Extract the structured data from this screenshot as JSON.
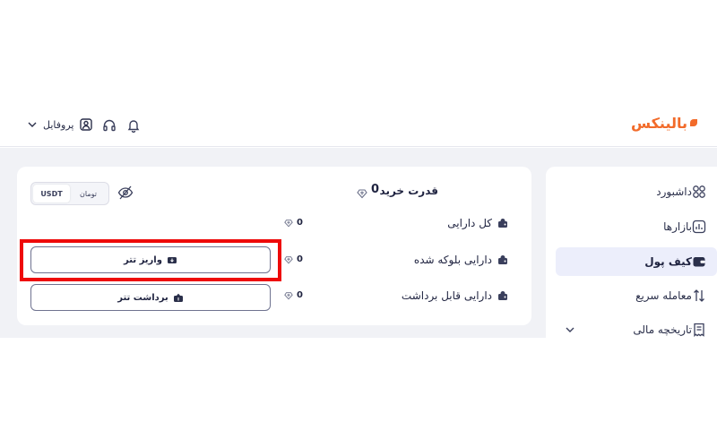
{
  "header": {
    "logo_text": "بالینکس",
    "profile_label": "پروفایل",
    "icons": [
      "bell-icon",
      "headset-icon",
      "user-icon",
      "chevron-down-icon"
    ]
  },
  "sidebar": {
    "items": [
      {
        "label": "داشبورد",
        "icon": "grid-icon",
        "active": false
      },
      {
        "label": "بازارها",
        "icon": "chart-icon",
        "active": false
      },
      {
        "label": "کیف پول",
        "icon": "wallet-icon",
        "active": true
      },
      {
        "label": "معامله سریع",
        "icon": "swap-icon",
        "active": false
      },
      {
        "label": "تاریخچه مالی",
        "icon": "receipt-icon",
        "active": false
      }
    ]
  },
  "wallet": {
    "buying_power_label": "قدرت خرید",
    "buying_power_value": "0",
    "currency_toggle": {
      "options": [
        "تومان",
        "USDT"
      ],
      "selected": "USDT"
    },
    "rows": [
      {
        "label": "کل دارایی",
        "value": "0"
      },
      {
        "label": "دارایی بلوکه شده",
        "value": "0"
      },
      {
        "label": "دارایی قابل برداشت",
        "value": "0"
      }
    ],
    "deposit_label": "واریز تتر",
    "withdraw_label": "برداشت تتر"
  },
  "colors": {
    "brand": "#f26b2a",
    "highlight": "#ee0a0a",
    "active_bg": "#eceefb",
    "band": "#f1f2f6"
  }
}
